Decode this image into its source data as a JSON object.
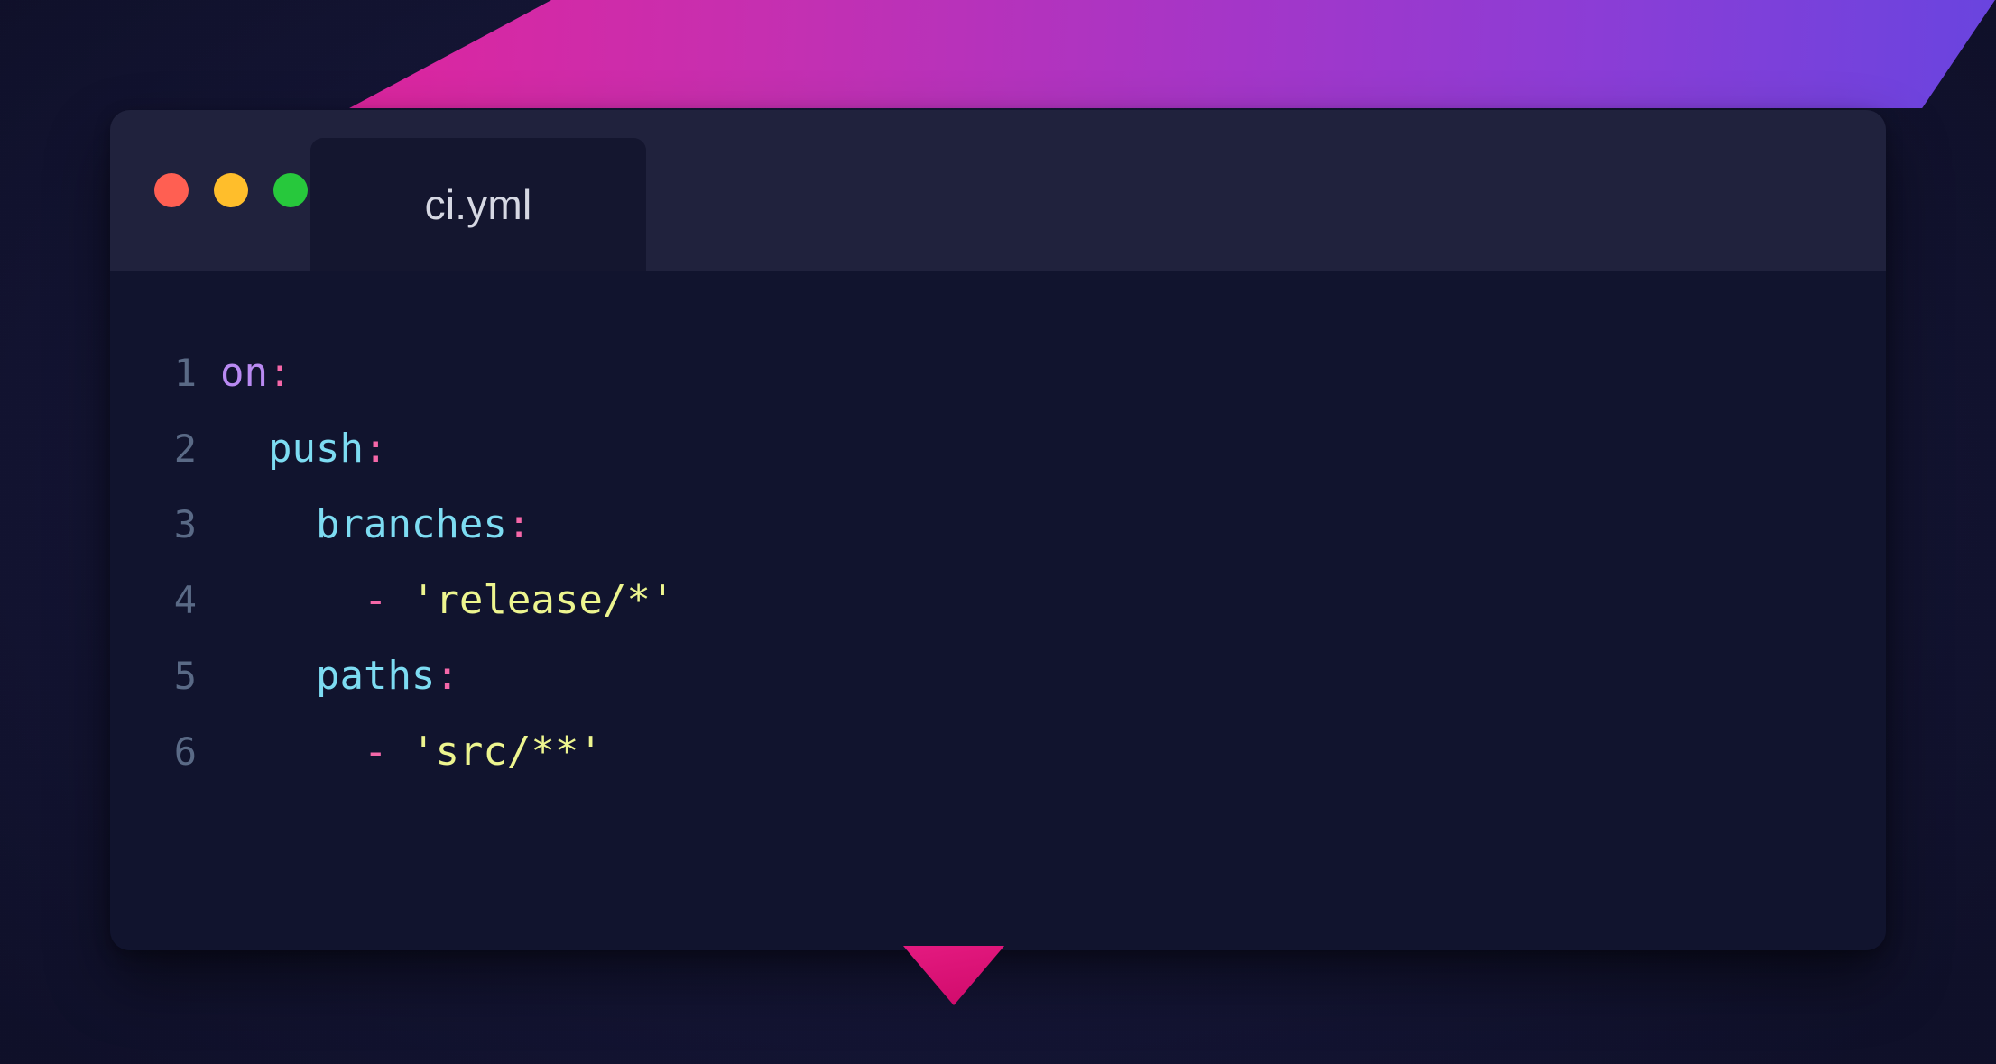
{
  "window": {
    "traffic_lights": [
      {
        "name": "close-button",
        "color": "#FF5F52"
      },
      {
        "name": "minimize-button",
        "color": "#FFBE2B"
      },
      {
        "name": "maximize-button",
        "color": "#27C83C"
      }
    ],
    "tabs": [
      {
        "label": "ci.yml",
        "active": true
      }
    ]
  },
  "editor": {
    "language": "yaml",
    "gutter": [
      "1",
      "2",
      "3",
      "4",
      "5",
      "6"
    ],
    "lines": [
      {
        "number": "1",
        "text": "on:",
        "tokens": [
          {
            "t": "on",
            "k": "anchor"
          },
          {
            "t": ":",
            "k": "punct"
          }
        ]
      },
      {
        "number": "2",
        "text": "  push:",
        "tokens": [
          {
            "t": "  ",
            "k": "plain"
          },
          {
            "t": "push",
            "k": "key"
          },
          {
            "t": ":",
            "k": "punct"
          }
        ]
      },
      {
        "number": "3",
        "text": "    branches:",
        "tokens": [
          {
            "t": "    ",
            "k": "plain"
          },
          {
            "t": "branches",
            "k": "key"
          },
          {
            "t": ":",
            "k": "punct"
          }
        ]
      },
      {
        "number": "4",
        "text": "      - 'release/*'",
        "tokens": [
          {
            "t": "      ",
            "k": "plain"
          },
          {
            "t": "-",
            "k": "dash"
          },
          {
            "t": " ",
            "k": "plain"
          },
          {
            "t": "'release/*'",
            "k": "str"
          }
        ]
      },
      {
        "number": "5",
        "text": "    paths:",
        "tokens": [
          {
            "t": "    ",
            "k": "plain"
          },
          {
            "t": "paths",
            "k": "key"
          },
          {
            "t": ":",
            "k": "punct"
          }
        ]
      },
      {
        "number": "6",
        "text": "      - 'src/**'",
        "tokens": [
          {
            "t": "      ",
            "k": "plain"
          },
          {
            "t": "-",
            "k": "dash"
          },
          {
            "t": " ",
            "k": "plain"
          },
          {
            "t": "'src/**'",
            "k": "str"
          }
        ]
      }
    ]
  },
  "theme": {
    "page_background": "#151537",
    "window_background": "#11142E",
    "titlebar_background": "#20223D",
    "tab_active_background": "#14162F",
    "tab_label_color": "#D6D8E3",
    "gutter_color": "#5A6A86",
    "anchor_color": "#B98AF2",
    "key_color": "#7DDCF2",
    "punct_color": "#F567A8",
    "string_color": "#EDF58F",
    "band_gradient_from": "#ED1E95",
    "band_gradient_to": "#6944DF",
    "triangle_color": "#DA0F72"
  }
}
